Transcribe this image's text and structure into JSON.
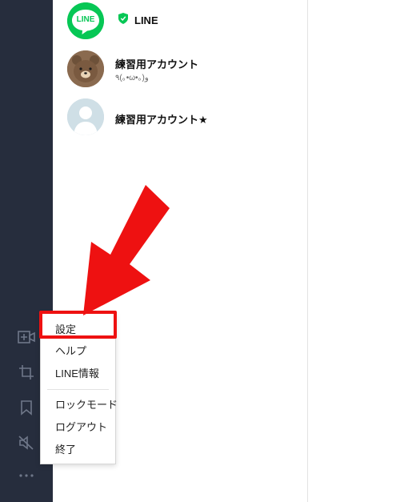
{
  "friends": [
    {
      "name": "LINE",
      "status": "",
      "avatar": "line-logo",
      "official": true
    },
    {
      "name": "練習用アカウント",
      "status": "٩(｡•ω•｡)و",
      "avatar": "bear"
    },
    {
      "name": "練習用アカウント★",
      "status": "",
      "avatar": "default-person"
    }
  ],
  "line_logo_text": "LINE",
  "menu": {
    "items": [
      "設定",
      "ヘルプ",
      "LINE情報",
      "ロックモード",
      "ログアウト",
      "終了"
    ]
  },
  "sidebar": {
    "icons": [
      "video-call-add-icon",
      "crop-icon",
      "bookmark-icon",
      "mute-icon",
      "more-icon"
    ]
  },
  "colors": {
    "sidebar_bg": "#262d3d",
    "line_green": "#06c755",
    "highlight_red": "#ee1111"
  }
}
